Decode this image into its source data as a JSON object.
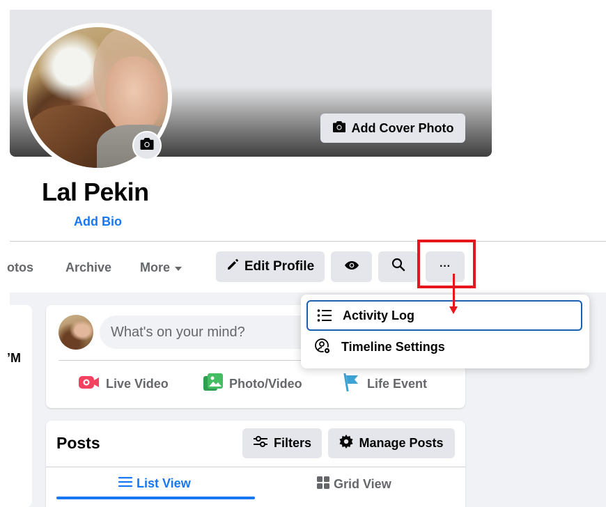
{
  "profile": {
    "name": "Lal Pekin",
    "bio_link": "Add Bio",
    "cover_button": "Add Cover Photo"
  },
  "tabs": {
    "photos_partial": "otos",
    "archive": "Archive",
    "more": "More"
  },
  "actions": {
    "edit_profile": "Edit Profile",
    "more_glyph": "···"
  },
  "dropdown": {
    "items": [
      {
        "label": "Activity Log",
        "icon": "list-icon",
        "selected": true
      },
      {
        "label": "Timeline Settings",
        "icon": "user-gear-icon",
        "selected": false
      }
    ]
  },
  "composer": {
    "placeholder": "What's on your mind?",
    "actions": [
      {
        "label": "Live Video",
        "icon": "live-video-icon",
        "color": "#f3425f"
      },
      {
        "label": "Photo/Video",
        "icon": "photo-icon",
        "color": "#45bd62"
      },
      {
        "label": "Life Event",
        "icon": "flag-icon",
        "color": "#3ea2d4"
      }
    ]
  },
  "left_column": {
    "fragment": "’M"
  },
  "posts": {
    "title": "Posts",
    "filters": "Filters",
    "manage": "Manage Posts",
    "views": [
      {
        "label": "List View",
        "active": true
      },
      {
        "label": "Grid View",
        "active": false
      }
    ]
  },
  "colors": {
    "accent": "#1877f2",
    "annotation": "#e5171d",
    "button_bg": "#e4e6eb",
    "feed_bg": "#f0f2f5"
  }
}
